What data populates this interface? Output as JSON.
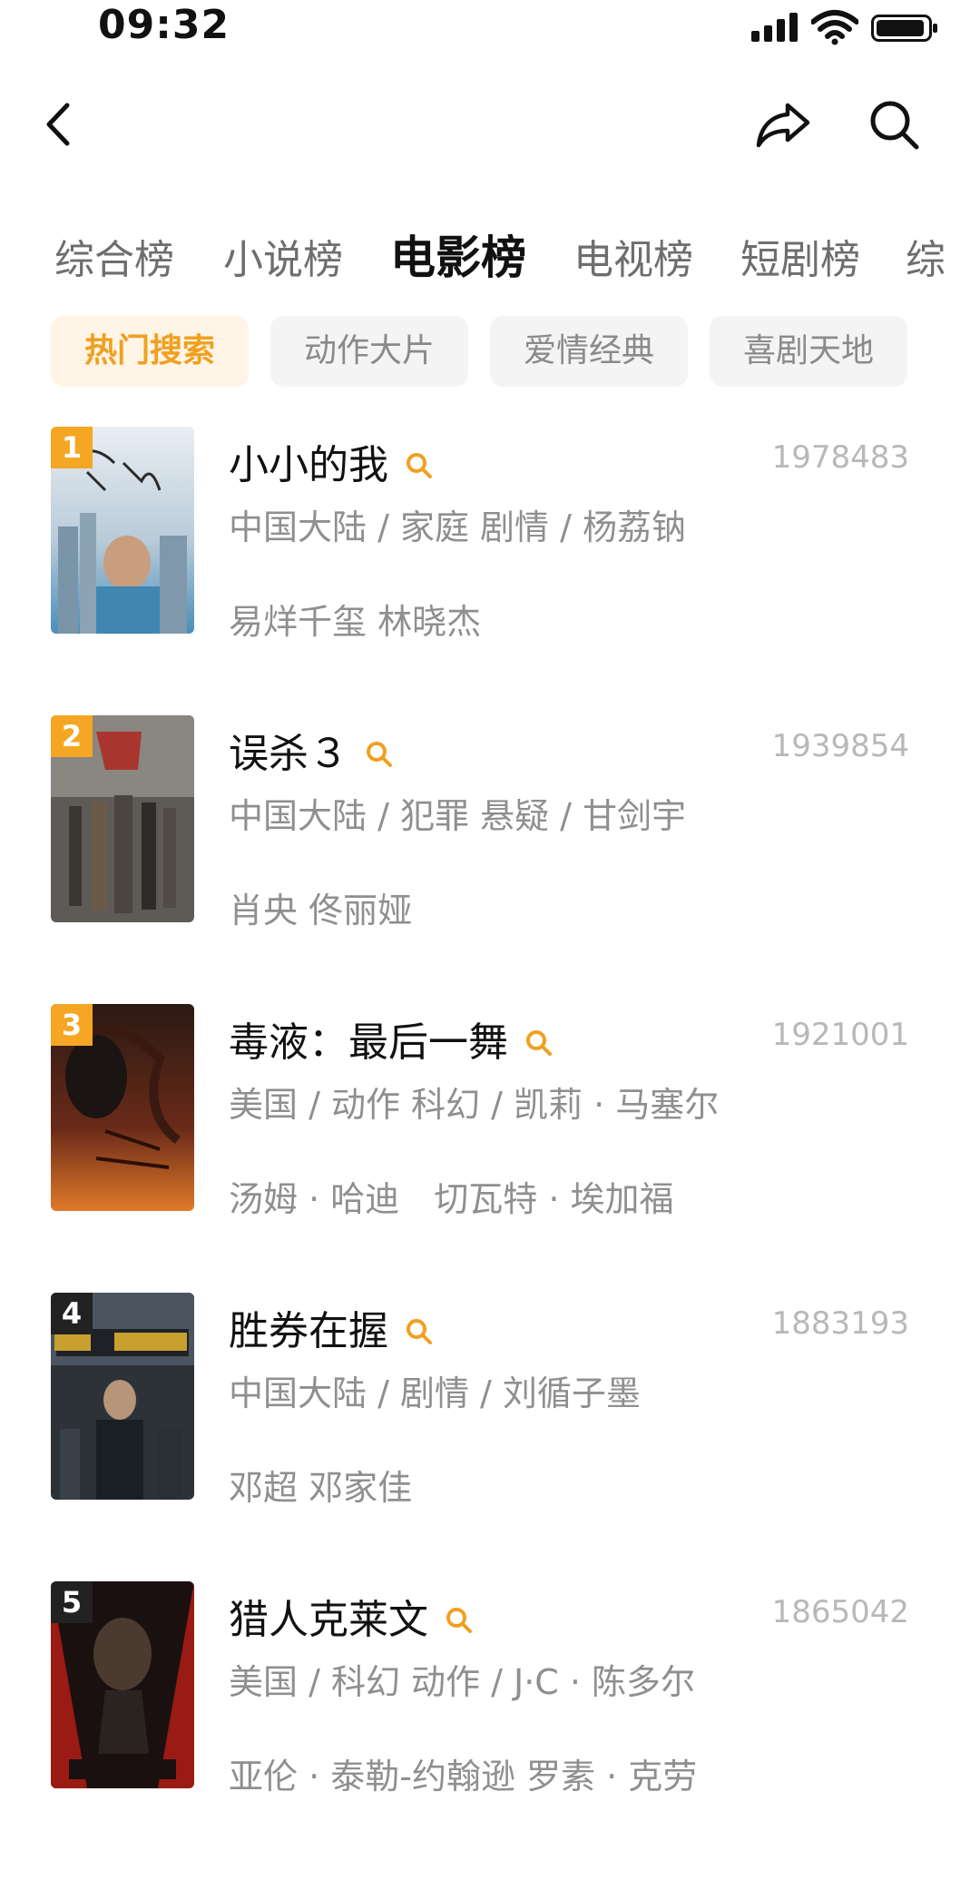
{
  "status_bar": {
    "time": "09:32"
  },
  "nav": {
    "back_icon": "chevron-left-icon",
    "share_icon": "share-icon",
    "search_icon": "search-icon"
  },
  "tabs": [
    {
      "label": "综合榜",
      "active": false
    },
    {
      "label": "小说榜",
      "active": false
    },
    {
      "label": "电影榜",
      "active": true
    },
    {
      "label": "电视榜",
      "active": false
    },
    {
      "label": "短剧榜",
      "active": false
    },
    {
      "label": "综",
      "active": false
    }
  ],
  "chips": [
    {
      "label": "热门搜索",
      "active": true
    },
    {
      "label": "动作大片",
      "active": false
    },
    {
      "label": "爱情经典",
      "active": false
    },
    {
      "label": "喜剧天地",
      "active": false
    }
  ],
  "colors": {
    "accent": "#f5a623",
    "chip_active_bg": "#fff4e6"
  },
  "items": [
    {
      "rank": "1",
      "title": "小小的我",
      "score": "1978483",
      "meta": "中国大陆 / 家庭 剧情 / 杨荔钠",
      "cast": "易烊千玺 林晓杰"
    },
    {
      "rank": "2",
      "title": "误杀３",
      "score": "1939854",
      "meta": "中国大陆 / 犯罪 悬疑 / 甘剑宇",
      "cast": "肖央 佟丽娅"
    },
    {
      "rank": "3",
      "title": "毒液：最后一舞",
      "score": "1921001",
      "meta": "美国 / 动作 科幻 / 凯莉 · 马塞尔",
      "cast": "汤姆 · 哈迪　切瓦特 · 埃加福"
    },
    {
      "rank": "4",
      "title": "胜券在握",
      "score": "1883193",
      "meta": "中国大陆 / 剧情 / 刘循子墨",
      "cast": "邓超 邓家佳"
    },
    {
      "rank": "5",
      "title": "猎人克莱文",
      "score": "1865042",
      "meta": "美国 / 科幻 动作 / J·C · 陈多尔",
      "cast": "亚伦 · 泰勒-约翰逊 罗素 · 克劳"
    }
  ]
}
